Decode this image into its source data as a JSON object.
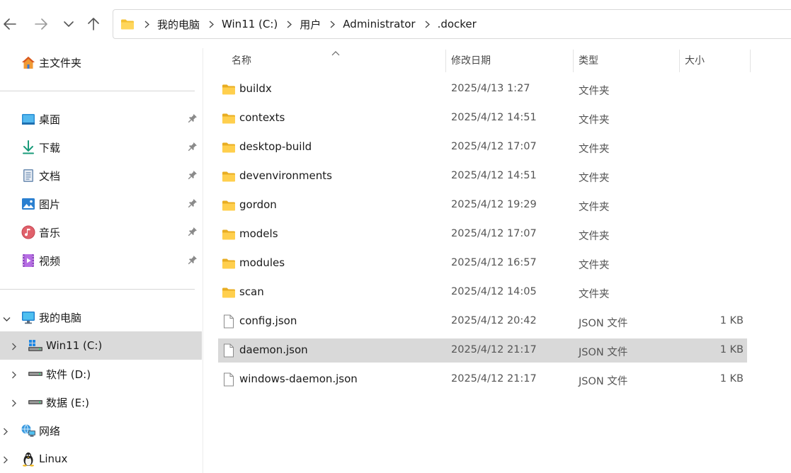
{
  "toolbar": {
    "back_icon": "arrow-left-icon",
    "forward_icon": "arrow-right-icon",
    "recent_icon": "chevron-down-icon",
    "up_icon": "arrow-up-icon"
  },
  "address": {
    "folder_icon": "folder-icon",
    "crumbs": [
      "我的电脑",
      "Win11 (C:)",
      "用户",
      "Administrator",
      ".docker"
    ]
  },
  "sidebar": {
    "home": {
      "label": "主文件夹",
      "icon": "home-icon"
    },
    "quick_access": [
      {
        "label": "桌面",
        "icon": "desktop-icon",
        "pinned": true
      },
      {
        "label": "下载",
        "icon": "download-icon",
        "pinned": true
      },
      {
        "label": "文档",
        "icon": "document-icon",
        "pinned": true
      },
      {
        "label": "图片",
        "icon": "picture-icon",
        "pinned": true
      },
      {
        "label": "音乐",
        "icon": "music-icon",
        "pinned": true
      },
      {
        "label": "视频",
        "icon": "video-icon",
        "pinned": true
      }
    ],
    "this_pc": {
      "label": "我的电脑",
      "icon": "computer-icon",
      "expanded": true
    },
    "drives": [
      {
        "label": "Win11 (C:)",
        "icon": "windows-drive-icon",
        "selected": true
      },
      {
        "label": "软件 (D:)",
        "icon": "drive-icon",
        "selected": false
      },
      {
        "label": "数据 (E:)",
        "icon": "drive-icon",
        "selected": false
      }
    ],
    "network": {
      "label": "网络",
      "icon": "network-icon"
    },
    "linux": {
      "label": "Linux",
      "icon": "linux-icon"
    }
  },
  "columns": {
    "name": "名称",
    "date": "修改日期",
    "type": "类型",
    "size": "大小"
  },
  "files": [
    {
      "name": "buildx",
      "date": "2025/4/13 1:27",
      "type": "文件夹",
      "size": "",
      "kind": "folder"
    },
    {
      "name": "contexts",
      "date": "2025/4/12 14:51",
      "type": "文件夹",
      "size": "",
      "kind": "folder"
    },
    {
      "name": "desktop-build",
      "date": "2025/4/12 17:07",
      "type": "文件夹",
      "size": "",
      "kind": "folder"
    },
    {
      "name": "devenvironments",
      "date": "2025/4/12 14:51",
      "type": "文件夹",
      "size": "",
      "kind": "folder"
    },
    {
      "name": "gordon",
      "date": "2025/4/12 19:29",
      "type": "文件夹",
      "size": "",
      "kind": "folder"
    },
    {
      "name": "models",
      "date": "2025/4/12 17:07",
      "type": "文件夹",
      "size": "",
      "kind": "folder"
    },
    {
      "name": "modules",
      "date": "2025/4/12 16:57",
      "type": "文件夹",
      "size": "",
      "kind": "folder"
    },
    {
      "name": "scan",
      "date": "2025/4/12 14:05",
      "type": "文件夹",
      "size": "",
      "kind": "folder"
    },
    {
      "name": "config.json",
      "date": "2025/4/12 20:42",
      "type": "JSON 文件",
      "size": "1 KB",
      "kind": "file"
    },
    {
      "name": "daemon.json",
      "date": "2025/4/12 21:17",
      "type": "JSON 文件",
      "size": "1 KB",
      "kind": "file",
      "selected": true
    },
    {
      "name": "windows-daemon.json",
      "date": "2025/4/12 21:17",
      "type": "JSON 文件",
      "size": "1 KB",
      "kind": "file"
    }
  ],
  "colors": {
    "folder": "#f4c032",
    "folder_dark": "#e3a21a",
    "selection": "#d9d9d9",
    "accent": "#0078d4"
  }
}
